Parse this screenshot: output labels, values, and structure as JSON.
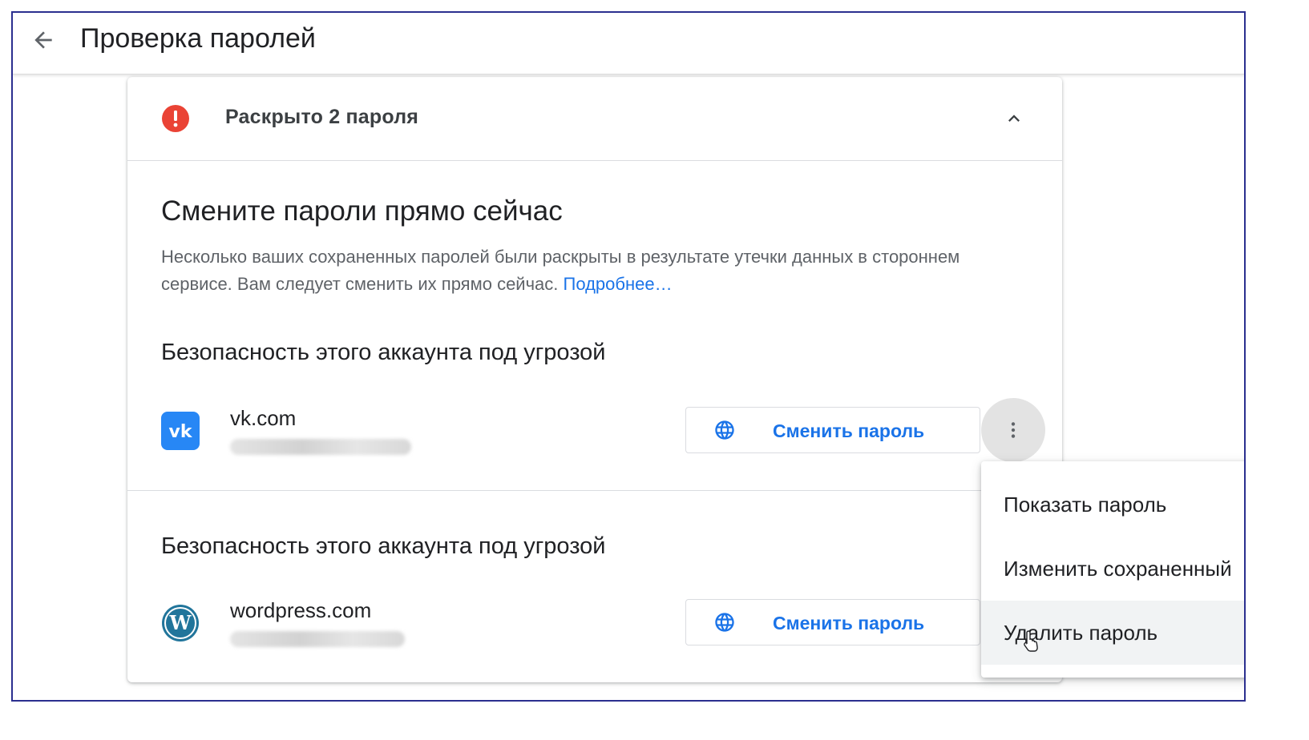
{
  "header": {
    "back_icon": "arrow-back-icon",
    "title": "Проверка паролей"
  },
  "card": {
    "header": {
      "alert_icon": "error-circle-icon",
      "alert_color": "#ea4335",
      "title": "Раскрыто 2 пароля",
      "collapse_icon": "chevron-up-icon"
    },
    "section_title": "Смените пароли прямо сейчас",
    "description": "Несколько ваших сохраненных паролей были раскрыты в результате утечки данных в стороннем сервисе. Вам следует сменить их прямо сейчас.",
    "learn_more": "Подробнее…",
    "items": [
      {
        "risk_title": "Безопасность этого аккаунта под угрозой",
        "site": "vk.com",
        "icon": "vk-logo-icon",
        "button_icon": "globe-icon",
        "button_label": "Сменить пароль"
      },
      {
        "risk_title": "Безопасность этого аккаунта под угрозой",
        "site": "wordpress.com",
        "icon": "wordpress-logo-icon",
        "button_icon": "globe-icon",
        "button_label": "Сменить пароль"
      }
    ]
  },
  "more_icon": "more-vert-icon",
  "menu": {
    "items": [
      "Показать пароль",
      "Изменить сохраненный",
      "Удалить пароль"
    ],
    "hovered": "Удалить пароль"
  },
  "colors": {
    "accent": "#1a73e8",
    "vk": "#2787f5",
    "wordpress": "#21759b"
  }
}
